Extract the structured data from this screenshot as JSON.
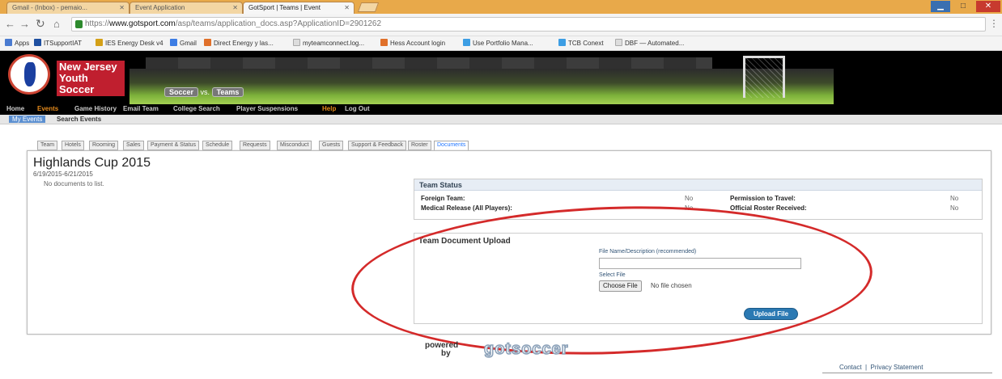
{
  "browser": {
    "tabs": [
      {
        "title": "Gmail - (Inbox) - pemaio...",
        "active": false
      },
      {
        "title": "Event Application",
        "active": false
      },
      {
        "title": "GotSport | Teams | Event",
        "active": true
      }
    ],
    "url_prefix": "https://",
    "url_host": "www.gotsport.com",
    "url_path": "/asp/teams/application_docs.asp?ApplicationID=2901262",
    "bookmarks": [
      {
        "label": "Apps",
        "color": "#4a7bd0"
      },
      {
        "label": "ITSupportIAT",
        "color": "#1e4fa0"
      },
      {
        "label": "IES Energy Desk v4",
        "color": "#d4a017"
      },
      {
        "label": "Gmail",
        "color": "#3d7de4"
      },
      {
        "label": "Direct Energy y las...",
        "color": "#e0702a"
      },
      {
        "label": "myteamconnect.log...",
        "color": "#dddddd"
      },
      {
        "label": "Hess Account login",
        "color": "#e0702a"
      },
      {
        "label": "Use Portfolio Mana...",
        "color": "#3d9ee4"
      },
      {
        "label": "TCB Conext",
        "color": "#3d9ee4"
      },
      {
        "label": "DBF — Automated...",
        "color": "#dddddd"
      }
    ]
  },
  "site": {
    "logo_text": "New Jersey Youth Soccer",
    "soccer_label": "Soccer",
    "vs_label": "vs.",
    "teams_label": "Teams",
    "nav": [
      {
        "label": "Home",
        "current": false
      },
      {
        "label": "Events",
        "current": true
      },
      {
        "label": "Game History",
        "current": false
      },
      {
        "label": "Email Team",
        "current": false
      },
      {
        "label": "College Search",
        "current": false
      },
      {
        "label": "Player Suspensions",
        "current": false
      },
      {
        "label": "Help",
        "current": true
      },
      {
        "label": "Log Out",
        "current": false
      }
    ],
    "subnav_selected": "My Events",
    "subnav_other": "Search Events"
  },
  "page_tabs": [
    {
      "label": "Team",
      "active": false
    },
    {
      "label": "Hotels",
      "active": false
    },
    {
      "label": "Rooming",
      "active": false
    },
    {
      "label": "Sales",
      "active": false
    },
    {
      "label": "Payment & Status",
      "active": false
    },
    {
      "label": "Schedule",
      "active": false
    },
    {
      "label": "Requests",
      "active": false
    },
    {
      "label": "Misconduct",
      "active": false
    },
    {
      "label": "Guests",
      "active": false
    },
    {
      "label": "Support & Feedback",
      "active": false
    },
    {
      "label": "Roster",
      "active": false
    },
    {
      "label": "Documents",
      "active": true
    }
  ],
  "event": {
    "title": "Highlands Cup 2015",
    "dates": "6/19/2015-6/21/2015",
    "no_docs": "No documents to list."
  },
  "team_status": {
    "heading": "Team Status",
    "rows": [
      {
        "label": "Foreign Team:",
        "value": "No"
      },
      {
        "label": "Permission to Travel:",
        "value": "No"
      },
      {
        "label": "Medical Release (All Players):",
        "value": "No"
      },
      {
        "label": "Official Roster Received:",
        "value": "No"
      }
    ]
  },
  "upload": {
    "title": "Team Document Upload",
    "file_name_label": "File Name/Description (recommended)",
    "file_name_value": "",
    "select_file_label": "Select File",
    "choose_button": "Choose File",
    "no_file": "No file chosen",
    "upload_button": "Upload File"
  },
  "footer": {
    "powered": "powered",
    "by": "by",
    "brand": "gotsoccer",
    "contact": "Contact",
    "privacy": "Privacy Statement"
  },
  "colors": {
    "annotation_ellipse": "#d42a2a",
    "active_tab_text": "#2277ff",
    "upload_button": "#2b79b3",
    "nav_current": "#e48a1c"
  }
}
